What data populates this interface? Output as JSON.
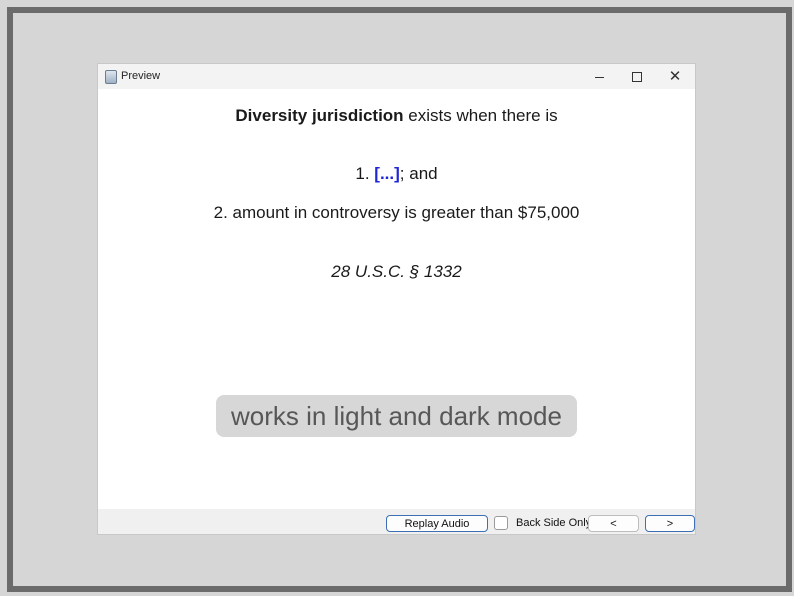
{
  "window": {
    "title": "Preview"
  },
  "window_controls": {
    "close": "✕"
  },
  "card": {
    "line1": {
      "bold": "Diversity jurisdiction",
      "rest": " exists when there is"
    },
    "line2": {
      "prefix": "1. ",
      "cloze": "[...]",
      "suffix": "; and"
    },
    "line3": "2. amount in controversy is greater than $75,000",
    "line4": "28 U.S.C. § 1332"
  },
  "overlay": {
    "text": "works in light and dark mode"
  },
  "toolbar": {
    "replay_label": "Replay Audio",
    "back_side_label": "Back Side Only",
    "prev_label": "<",
    "next_label": ">"
  },
  "state": {
    "back_side_only_checked": false
  },
  "colors": {
    "cloze": "#1f24d6",
    "accent_border": "#3d6fb5"
  },
  "icons": {
    "app": "preview-app-icon",
    "minimize": "minimize-icon",
    "maximize": "maximize-icon",
    "close": "close-icon"
  }
}
